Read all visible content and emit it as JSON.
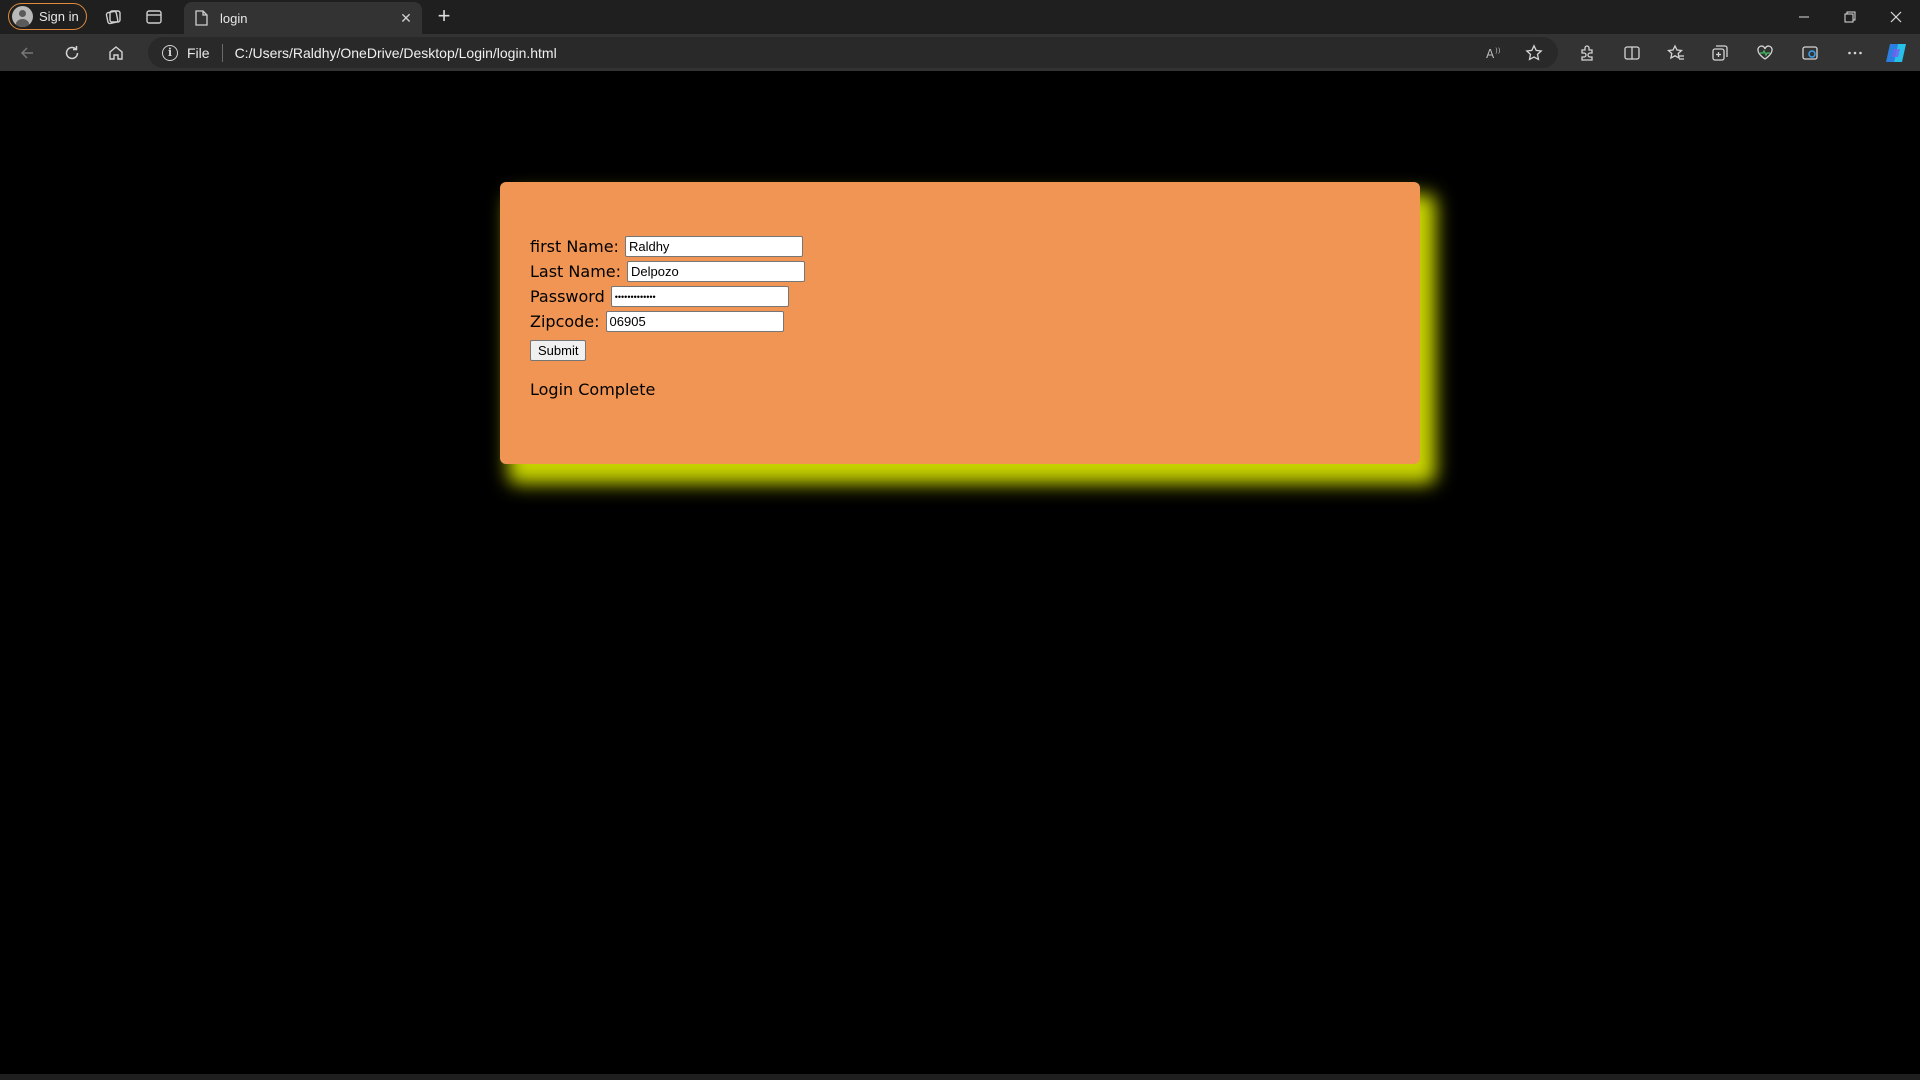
{
  "browser": {
    "profile": {
      "label": "Sign in"
    },
    "tab": {
      "title": "login"
    },
    "address": {
      "scheme_label": "File",
      "url": "C:/Users/Raldhy/OneDrive/Desktop/Login/login.html"
    },
    "icons": {
      "workspaces": "workspaces-icon",
      "tab_actions": "tab-actions-icon",
      "read_aloud": "read-aloud-icon",
      "favorite": "star-icon",
      "extensions": "puzzle-icon",
      "split_screen": "split-screen-icon",
      "favorites": "favorites-icon",
      "collections": "collections-icon",
      "browser_essentials": "heart-pulse-icon",
      "edge_bar": "edge-icon",
      "more": "more-icon",
      "copilot": "copilot-icon"
    }
  },
  "page": {
    "background_color": "#000000",
    "card_color": "#f09553",
    "card_shadow_color": "#c7d300",
    "form": {
      "first_name_label": "first Name:",
      "first_name_value": "Raldhy",
      "last_name_label": "Last Name:",
      "last_name_value": "Delpozo",
      "password_label": "Password",
      "password_value": "•••••••••••••",
      "zipcode_label": "Zipcode:",
      "zipcode_value": "06905",
      "submit_label": "Submit"
    },
    "status_message": "Login Complete"
  }
}
